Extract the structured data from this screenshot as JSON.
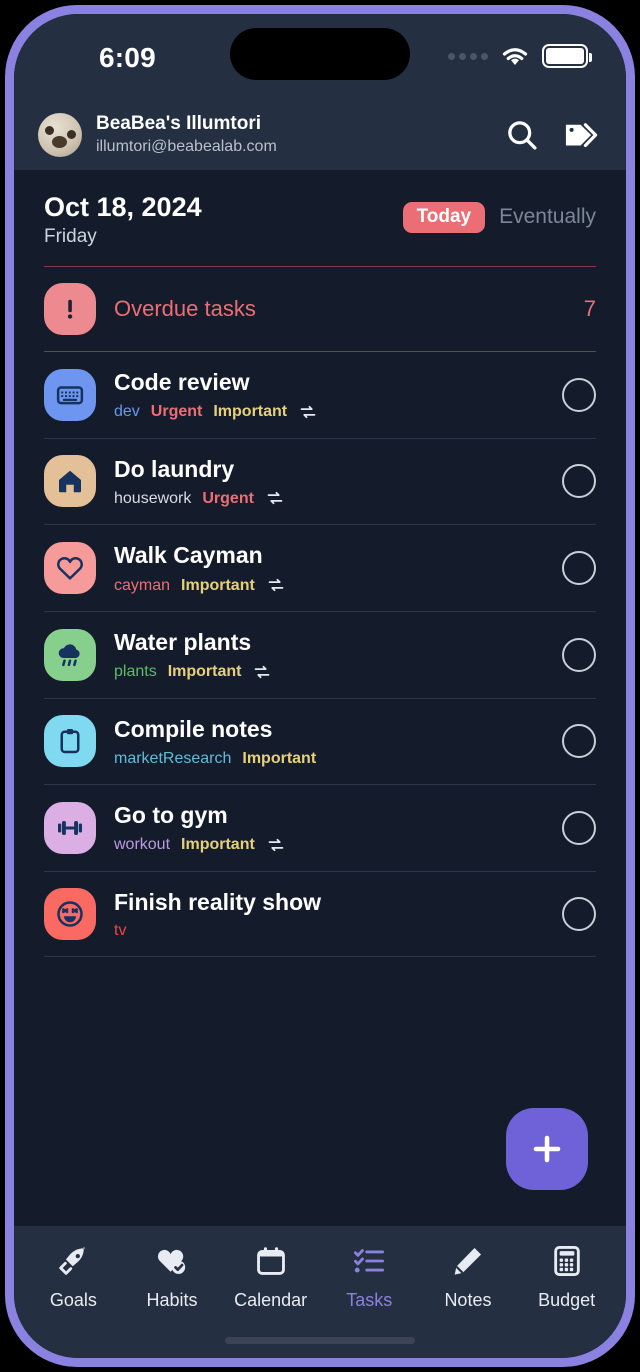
{
  "status_bar": {
    "time": "6:09",
    "cellular_icon": "signal-dots-icon",
    "wifi_icon": "wifi-icon",
    "battery_icon": "battery-full-icon"
  },
  "account_header": {
    "avatar_icon": "avatar",
    "name": "BeaBea's Illumtori",
    "email": "illumtori@beabealab.com",
    "search_icon": "search-icon",
    "tags_icon": "tags-icon"
  },
  "date_header": {
    "date": "Oct 18, 2024",
    "weekday": "Friday",
    "segments": [
      {
        "label": "Today",
        "active": true
      },
      {
        "label": "Eventually",
        "active": false
      }
    ]
  },
  "overdue": {
    "icon": "alert-icon",
    "label": "Overdue tasks",
    "count": "7",
    "color": "#ec6e75"
  },
  "tasks": [
    {
      "title": "Code review",
      "icon": "keyboard-icon",
      "icon_bg": "#6e96f0",
      "icon_fg": "#16325f",
      "repeat": true,
      "tags": [
        {
          "text": "dev",
          "color": "#6e96f0",
          "bold": false
        },
        {
          "text": "Urgent",
          "color": "#ec6e75",
          "bold": true
        },
        {
          "text": "Important",
          "color": "#e8d07a",
          "bold": true
        }
      ]
    },
    {
      "title": "Do laundry",
      "icon": "home-icon",
      "icon_bg": "#e3c097",
      "icon_fg": "#16325f",
      "repeat": true,
      "tags": [
        {
          "text": "housework",
          "color": "#d7dbe2",
          "bold": false
        },
        {
          "text": "Urgent",
          "color": "#ec6e75",
          "bold": true
        }
      ]
    },
    {
      "title": "Walk Cayman",
      "icon": "heart-icon",
      "icon_bg": "#f79a9a",
      "icon_fg": "#16325f",
      "repeat": true,
      "tags": [
        {
          "text": "cayman",
          "color": "#ec6e75",
          "bold": false
        },
        {
          "text": "Important",
          "color": "#e8d07a",
          "bold": true
        }
      ]
    },
    {
      "title": "Water plants",
      "icon": "rain-cloud-icon",
      "icon_bg": "#86cf8c",
      "icon_fg": "#16325f",
      "repeat": true,
      "tags": [
        {
          "text": "plants",
          "color": "#5dbb6b",
          "bold": false
        },
        {
          "text": "Important",
          "color": "#e8d07a",
          "bold": true
        }
      ]
    },
    {
      "title": "Compile notes",
      "icon": "clipboard-icon",
      "icon_bg": "#7fd9f0",
      "icon_fg": "#16325f",
      "repeat": false,
      "tags": [
        {
          "text": "marketResearch",
          "color": "#5fbdd8",
          "bold": false
        },
        {
          "text": "Important",
          "color": "#e8d07a",
          "bold": true
        }
      ]
    },
    {
      "title": "Go to gym",
      "icon": "dumbbell-icon",
      "icon_bg": "#dbaee4",
      "icon_fg": "#16325f",
      "repeat": true,
      "tags": [
        {
          "text": "workout",
          "color": "#b99ae0",
          "bold": false
        },
        {
          "text": "Important",
          "color": "#e8d07a",
          "bold": true
        }
      ]
    },
    {
      "title": "Finish reality show",
      "icon": "laughing-face-icon",
      "icon_bg": "#fa6a63",
      "icon_fg": "#16325f",
      "repeat": false,
      "tags": [
        {
          "text": "tv",
          "color": "#e8484b",
          "bold": false
        }
      ]
    }
  ],
  "fab": {
    "icon": "plus-icon",
    "color": "#6f62d8"
  },
  "bottom_nav": {
    "active_color": "#8b81e0",
    "items": [
      {
        "label": "Goals",
        "icon": "rocket-icon",
        "active": false
      },
      {
        "label": "Habits",
        "icon": "heart-check-icon",
        "active": false
      },
      {
        "label": "Calendar",
        "icon": "calendar-icon",
        "active": false
      },
      {
        "label": "Tasks",
        "icon": "checklist-icon",
        "active": true
      },
      {
        "label": "Notes",
        "icon": "pencil-icon",
        "active": false
      },
      {
        "label": "Budget",
        "icon": "calculator-icon",
        "active": false
      }
    ]
  }
}
